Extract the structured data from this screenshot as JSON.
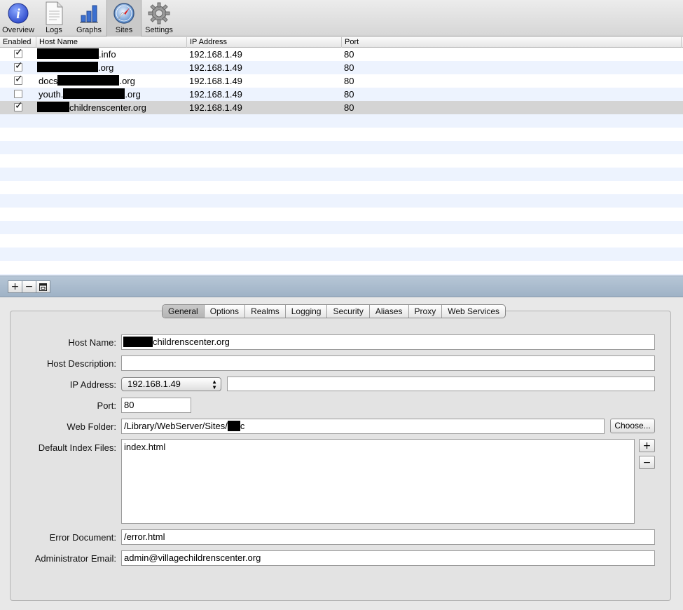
{
  "toolbar": {
    "items": [
      {
        "label": "Overview",
        "icon": "info-icon"
      },
      {
        "label": "Logs",
        "icon": "document-icon"
      },
      {
        "label": "Graphs",
        "icon": "bar-chart-icon"
      },
      {
        "label": "Sites",
        "icon": "compass-icon",
        "active": true
      },
      {
        "label": "Settings",
        "icon": "gear-icon"
      }
    ]
  },
  "table": {
    "columns": [
      "Enabled",
      "Host Name",
      "IP Address",
      "Port"
    ],
    "rows": [
      {
        "enabled": true,
        "host_prefix": "",
        "host_suffix": ".info",
        "ip": "192.168.1.49",
        "port": "80"
      },
      {
        "enabled": true,
        "host_prefix": "",
        "host_suffix": ".org",
        "ip": "192.168.1.49",
        "port": "80"
      },
      {
        "enabled": true,
        "host_prefix": "docs",
        "host_suffix": ".org",
        "ip": "192.168.1.49",
        "port": "80"
      },
      {
        "enabled": false,
        "host_prefix": "youth.",
        "host_suffix": ".org",
        "ip": "192.168.1.49",
        "port": "80"
      },
      {
        "enabled": true,
        "host_prefix": "",
        "host_suffix": "childrenscenter.org",
        "ip": "192.168.1.49",
        "port": "80",
        "selected": true
      }
    ]
  },
  "actions": {
    "add": "+",
    "remove": "−",
    "duplicate": "⧉"
  },
  "tabs": [
    "General",
    "Options",
    "Realms",
    "Logging",
    "Security",
    "Aliases",
    "Proxy",
    "Web Services"
  ],
  "active_tab": "General",
  "form": {
    "host_name_label": "Host Name:",
    "host_name_value": "childrenscenter.org",
    "host_description_label": "Host Description:",
    "host_description_value": "",
    "ip_address_label": "IP Address:",
    "ip_address_value": "192.168.1.49",
    "ip_address_extra": "",
    "port_label": "Port:",
    "port_value": "80",
    "web_folder_label": "Web Folder:",
    "web_folder_value_prefix": "/Library/WebServer/Sites/",
    "web_folder_value_suffix": "c",
    "choose_button": "Choose...",
    "default_index_label": "Default Index Files:",
    "default_index_value": "index.html",
    "index_add": "+",
    "index_remove": "−",
    "error_document_label": "Error Document:",
    "error_document_value": "/error.html",
    "admin_email_label": "Administrator Email:",
    "admin_email_value": "admin@villagechildrenscenter.org"
  }
}
